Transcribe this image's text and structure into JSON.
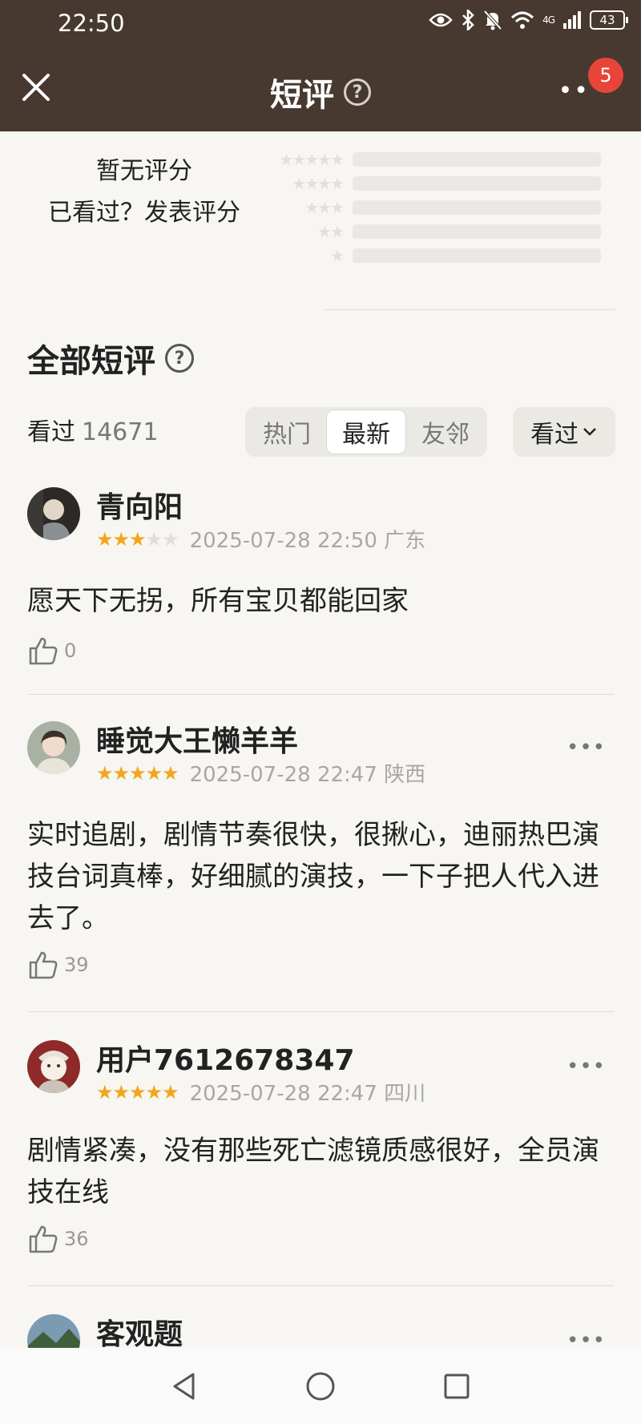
{
  "status": {
    "time": "22:50",
    "signal": "4G",
    "battery": "43"
  },
  "header": {
    "title": "短评",
    "help": "?",
    "more": "••",
    "badge": "5"
  },
  "rating": {
    "no_score": "暂无评分",
    "prompt": "已看过？发表评分",
    "rows": [
      {
        "stars": "★★★★★"
      },
      {
        "stars": "★★★★"
      },
      {
        "stars": "★★★"
      },
      {
        "stars": "★★"
      },
      {
        "stars": "★"
      }
    ]
  },
  "section": {
    "title": "全部短评",
    "help": "?"
  },
  "seen": {
    "label": "看过",
    "count": "14671"
  },
  "tabs": [
    "热门",
    "最新",
    "友邻"
  ],
  "active_tab": "最新",
  "filter": {
    "label": "看过"
  },
  "comments": [
    {
      "name": "青向阳",
      "rating": 3,
      "time": "2025-07-28 22:50 广东",
      "text": "愿天下无拐，所有宝贝都能回家",
      "likes": "0"
    },
    {
      "name": "睡觉大王懒羊羊",
      "rating": 5,
      "time": "2025-07-28 22:47 陕西",
      "text": "实时追剧，剧情节奏很快，很揪心，迪丽热巴演技台词真棒，好细腻的演技，一下子把人代入进去了。",
      "likes": "39"
    },
    {
      "name": "用户7612678347",
      "rating": 5,
      "time": "2025-07-28 22:47 四川",
      "text": "剧情紧凑，没有那些死亡滤镜质感很好，全员演技在线",
      "likes": "36"
    },
    {
      "name": "客观题"
    }
  ],
  "colors": {
    "header_bg": "#47392f",
    "star": "#f5a41f",
    "badge": "#e9443a",
    "page_bg": "#f7f6f2"
  }
}
